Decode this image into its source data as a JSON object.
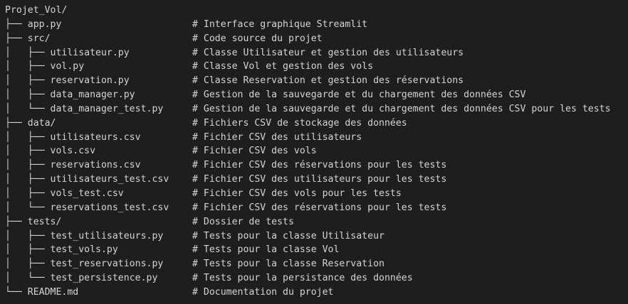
{
  "root": {
    "name": "Projet_Vol/"
  },
  "lines": [
    {
      "prefix": "├── ",
      "name": "app.py",
      "comment": "# Interface graphique Streamlit"
    },
    {
      "prefix": "├── ",
      "name": "src/",
      "comment": "# Code source du projet"
    },
    {
      "prefix": "│   ├── ",
      "name": "utilisateur.py",
      "comment": "# Classe Utilisateur et gestion des utilisateurs"
    },
    {
      "prefix": "│   ├── ",
      "name": "vol.py",
      "comment": "# Classe Vol et gestion des vols"
    },
    {
      "prefix": "│   ├── ",
      "name": "reservation.py",
      "comment": "# Classe Reservation et gestion des réservations"
    },
    {
      "prefix": "│   ├── ",
      "name": "data_manager.py",
      "comment": "# Gestion de la sauvegarde et du chargement des données CSV"
    },
    {
      "prefix": "│   └── ",
      "name": "data_manager_test.py",
      "comment": "# Gestion de la sauvegarde et du chargement des données CSV pour les tests"
    },
    {
      "prefix": "├── ",
      "name": "data/",
      "comment": "# Fichiers CSV de stockage des données"
    },
    {
      "prefix": "│   ├── ",
      "name": "utilisateurs.csv",
      "comment": "# Fichier CSV des utilisateurs"
    },
    {
      "prefix": "│   ├── ",
      "name": "vols.csv",
      "comment": "# Fichier CSV des vols"
    },
    {
      "prefix": "│   ├── ",
      "name": "reservations.csv",
      "comment": "# Fichier CSV des réservations pour les tests"
    },
    {
      "prefix": "│   ├── ",
      "name": "utilisateurs_test.csv",
      "comment": "# Fichier CSV des utilisateurs pour les tests"
    },
    {
      "prefix": "│   ├── ",
      "name": "vols_test.csv",
      "comment": "# Fichier CSV des vols pour les tests"
    },
    {
      "prefix": "│   └── ",
      "name": "reservations_test.csv",
      "comment": "# Fichier CSV des réservations pour les tests"
    },
    {
      "prefix": "├── ",
      "name": "tests/",
      "comment": "# Dossier de tests"
    },
    {
      "prefix": "│   ├── ",
      "name": "test_utilisateurs.py",
      "comment": "# Tests pour la classe Utilisateur"
    },
    {
      "prefix": "│   ├── ",
      "name": "test_vols.py",
      "comment": "# Tests pour la classe Vol"
    },
    {
      "prefix": "│   ├── ",
      "name": "test_reservations.py",
      "comment": "# Tests pour la classe Reservation"
    },
    {
      "prefix": "│   └── ",
      "name": "test_persistence.py",
      "comment": "# Tests pour la persistance des données"
    },
    {
      "prefix": "└── ",
      "name": "README.md",
      "comment": "# Documentation du projet"
    }
  ]
}
